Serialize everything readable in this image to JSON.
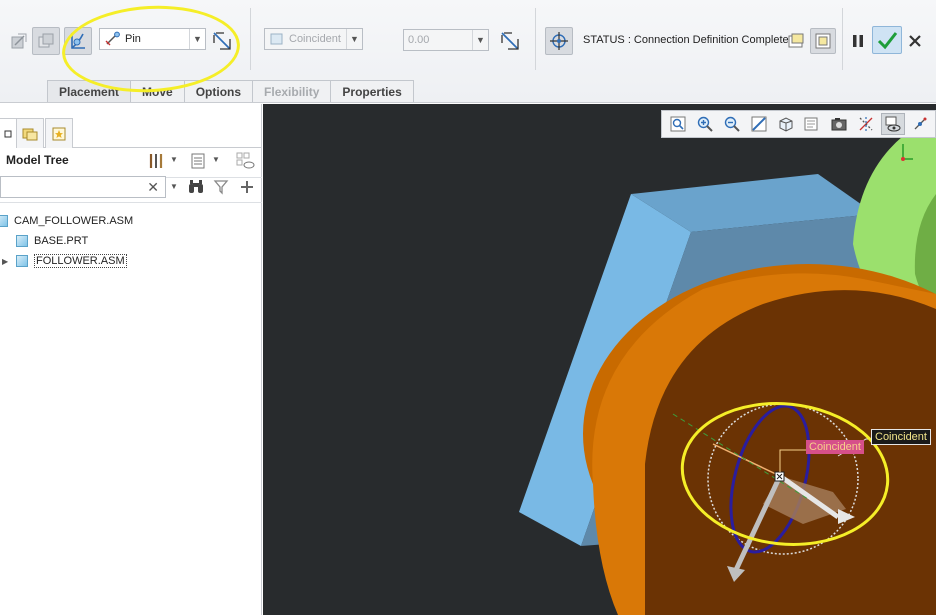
{
  "toolbar": {
    "connection_type": "Pin",
    "constraint_type": "Coincident",
    "offset_value": "0.00",
    "status_text": "STATUS : Connection Definition Complete."
  },
  "tabs": [
    {
      "label": "Placement"
    },
    {
      "label": "Move"
    },
    {
      "label": "Options"
    },
    {
      "label": "Flexibility"
    },
    {
      "label": "Properties"
    }
  ],
  "model_tree": {
    "title": "Model Tree",
    "search_placeholder": "",
    "items": [
      {
        "label": "CAM_FOLLOWER.ASM"
      },
      {
        "label": "BASE.PRT"
      },
      {
        "label": "FOLLOWER.ASM"
      }
    ]
  },
  "viewport": {
    "tag_pink": "Coincident",
    "tag_black": "Coincident"
  },
  "colors": {
    "highlight": "#f5ee28",
    "accept_green": "#1d9e3a",
    "background_3d": "#282b2d"
  }
}
